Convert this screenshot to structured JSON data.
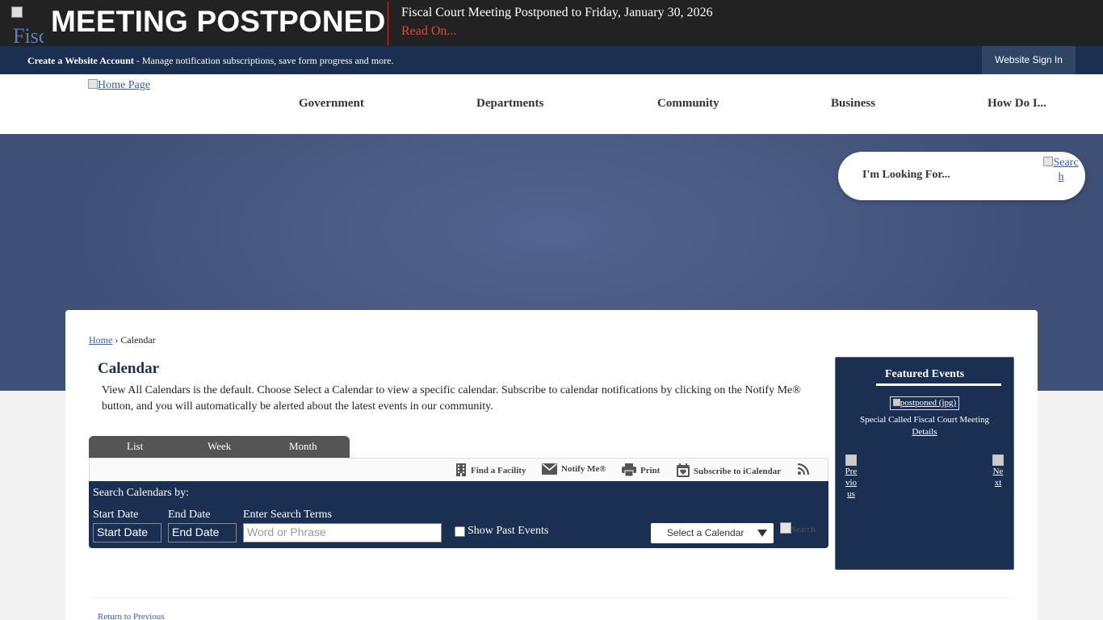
{
  "alert": {
    "image_alt": "Fiscal",
    "title": "MEETING POSTPONED",
    "headline": "Fiscal Court Meeting Postponed to Friday, January 30, 2026",
    "link": "Read On..."
  },
  "account": {
    "create_label": "Create a Website Account",
    "create_desc": " - Manage notification subscriptions, save form progress and more.",
    "signin": "Website Sign In"
  },
  "header": {
    "logo_alt": "Home Page",
    "nav": [
      "Government",
      "Departments",
      "Community",
      "Business",
      "How Do I..."
    ]
  },
  "site_search": {
    "label": "I'm Looking For...",
    "button_alt_1": "Searc",
    "button_alt_2": "h"
  },
  "breadcrumb": {
    "home": "Home",
    "separator": " › ",
    "current": "Calendar"
  },
  "page": {
    "title": "Calendar",
    "description": "View All Calendars is the default. Choose Select a Calendar to view a specific calendar. Subscribe to calendar notifications by clicking on the Notify Me® button, and you will automatically be alerted about the latest events in our community."
  },
  "tabs": [
    "List",
    "Week",
    "Month"
  ],
  "toolbar": {
    "find_facility": "Find a Facility",
    "notify_me": "Notify Me®",
    "print": "Print",
    "subscribe": "Subscribe to iCalendar"
  },
  "calendar_search": {
    "title": "Search Calendars by:",
    "start_label": "Start Date",
    "start_value": "Start Date",
    "end_label": "End Date",
    "end_value": "End Date",
    "terms_label": "Enter Search Terms",
    "terms_placeholder": "Word or Phrase",
    "past_events": "Show Past Events",
    "select_calendar": "Select a Calendar",
    "search_alt": "Search"
  },
  "featured": {
    "title": "Featured Events",
    "image_alt": "postponed (jpg)",
    "caption": "Special Called Fiscal Court Meeting",
    "details": "Details",
    "previous": "Previous",
    "next": "Next"
  },
  "footer_link": "Return to Previous",
  "colors": {
    "navy": "#1a2f52",
    "alert_bg": "#222222",
    "alert_link": "#e8472f",
    "hero": "#4a5b84"
  }
}
